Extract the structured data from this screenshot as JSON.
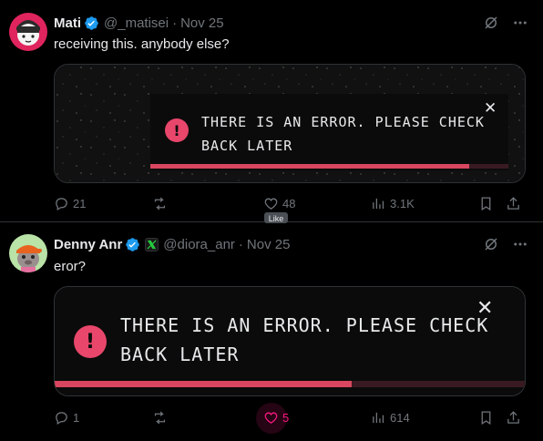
{
  "colors": {
    "background": "#000000",
    "text_primary": "#e7e9ea",
    "text_secondary": "#71767b",
    "verified_blue": "#1d9bf0",
    "error_pink": "#e8466b",
    "like_pink": "#f91880"
  },
  "tweets": [
    {
      "name": "Mati",
      "handle": "@_matisei",
      "separator": "·",
      "date": "Nov 25",
      "text": "receiving this. anybody else?",
      "image": {
        "error_line1": "THERE IS AN ERROR. PLEASE CHECK",
        "error_line2": "BACK LATER",
        "error_icon_glyph": "!",
        "close_glyph": "✕",
        "progress_fraction": 0.89
      },
      "actions": {
        "replies": "21",
        "reposts": "",
        "likes": "48",
        "views": "3.1K"
      },
      "icons": [
        "grok-icon",
        "more-icon",
        "reply-icon",
        "repost-icon",
        "like-icon",
        "views-icon",
        "bookmark-icon",
        "share-icon"
      ]
    },
    {
      "name": "Denny Anr",
      "handle": "@diora_anr",
      "separator": "·",
      "date": "Nov 25",
      "text": "eror?",
      "image": {
        "error_line1": "THERE IS AN ERROR. PLEASE CHECK",
        "error_line2": "BACK LATER",
        "error_icon_glyph": "!",
        "close_glyph": "✕",
        "progress_fraction": 0.63
      },
      "actions": {
        "replies": "1",
        "reposts": "",
        "likes": "5",
        "views": "614"
      },
      "tooltip": "Like",
      "icons": [
        "grok-icon",
        "more-icon",
        "reply-icon",
        "repost-icon",
        "like-icon",
        "views-icon",
        "bookmark-icon",
        "share-icon",
        "affiliate-badge-icon"
      ]
    }
  ]
}
